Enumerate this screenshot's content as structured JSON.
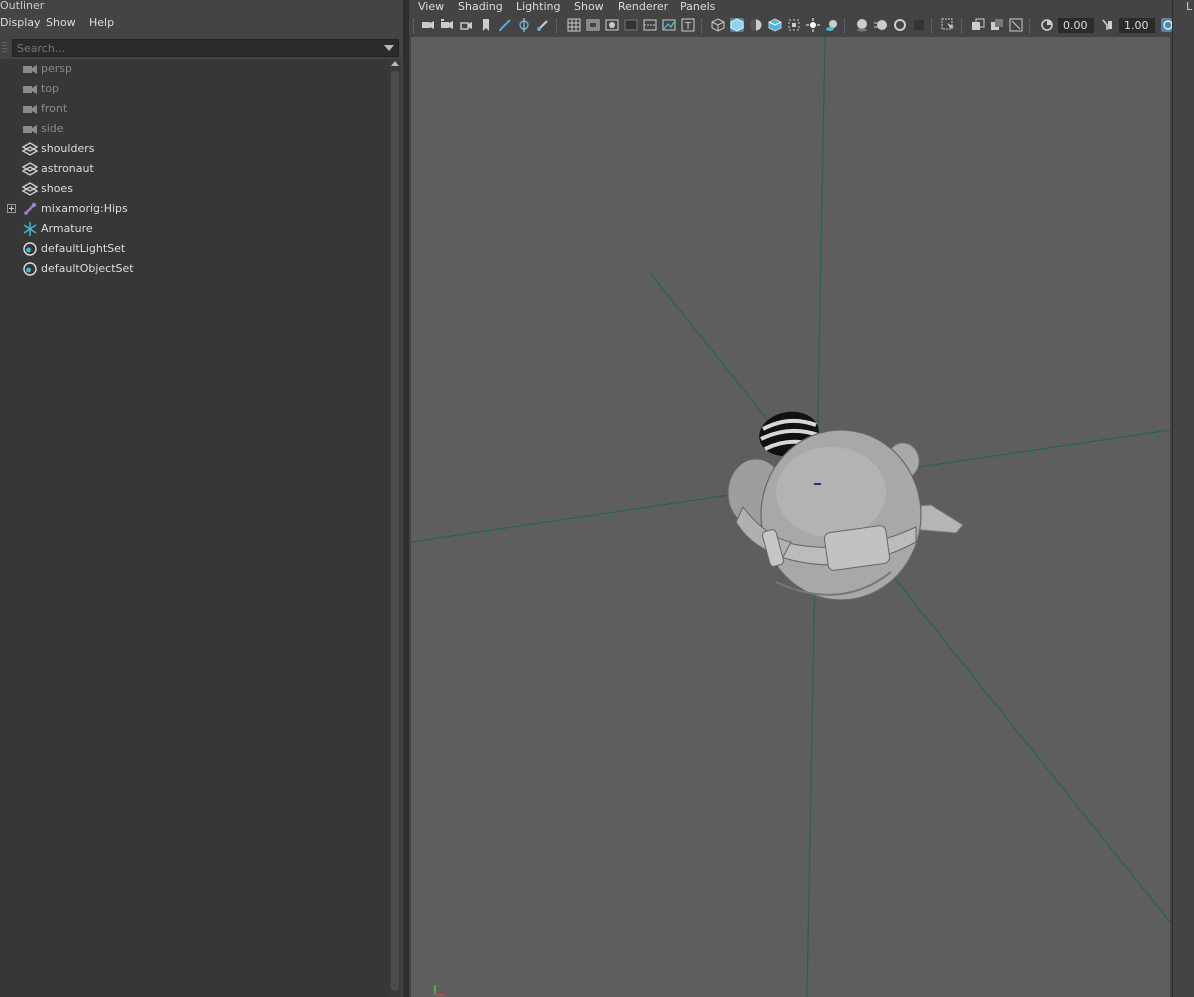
{
  "outliner": {
    "title": "Outliner",
    "menu": [
      "Display",
      "Show",
      "Help"
    ],
    "search": {
      "placeholder": "Search..."
    },
    "items": [
      {
        "label": "persp",
        "icon": "camera-icon",
        "dim": true
      },
      {
        "label": "top",
        "icon": "camera-icon",
        "dim": true
      },
      {
        "label": "front",
        "icon": "camera-icon",
        "dim": true
      },
      {
        "label": "side",
        "icon": "camera-icon",
        "dim": true
      },
      {
        "label": "shoulders",
        "icon": "mesh-icon",
        "dim": false
      },
      {
        "label": "astronaut",
        "icon": "mesh-icon",
        "dim": false
      },
      {
        "label": "shoes",
        "icon": "mesh-icon",
        "dim": false
      },
      {
        "label": "mixamorig:Hips",
        "icon": "joint-icon",
        "dim": false,
        "expandable": true
      },
      {
        "label": "Armature",
        "icon": "armature-icon",
        "dim": false
      },
      {
        "label": "defaultLightSet",
        "icon": "set-icon",
        "dim": false
      },
      {
        "label": "defaultObjectSet",
        "icon": "set-icon",
        "dim": false
      }
    ]
  },
  "viewport": {
    "menu": [
      "View",
      "Shading",
      "Lighting",
      "Show",
      "Renderer",
      "Panels"
    ],
    "toolbar": {
      "exposure_value": "0.00",
      "gamma_value": "1.00"
    },
    "scene": {
      "object": "astronaut",
      "grid_color": "#1f6b3a",
      "background_color": "#5e5e5e"
    }
  },
  "right_panel": {
    "label": "L"
  },
  "colors": {
    "panel_bg": "#444444",
    "tree_bg": "#373737",
    "accent": "#5285a6",
    "joint_icon": "#9b7fd4",
    "armature_icon": "#3fb6c9"
  }
}
